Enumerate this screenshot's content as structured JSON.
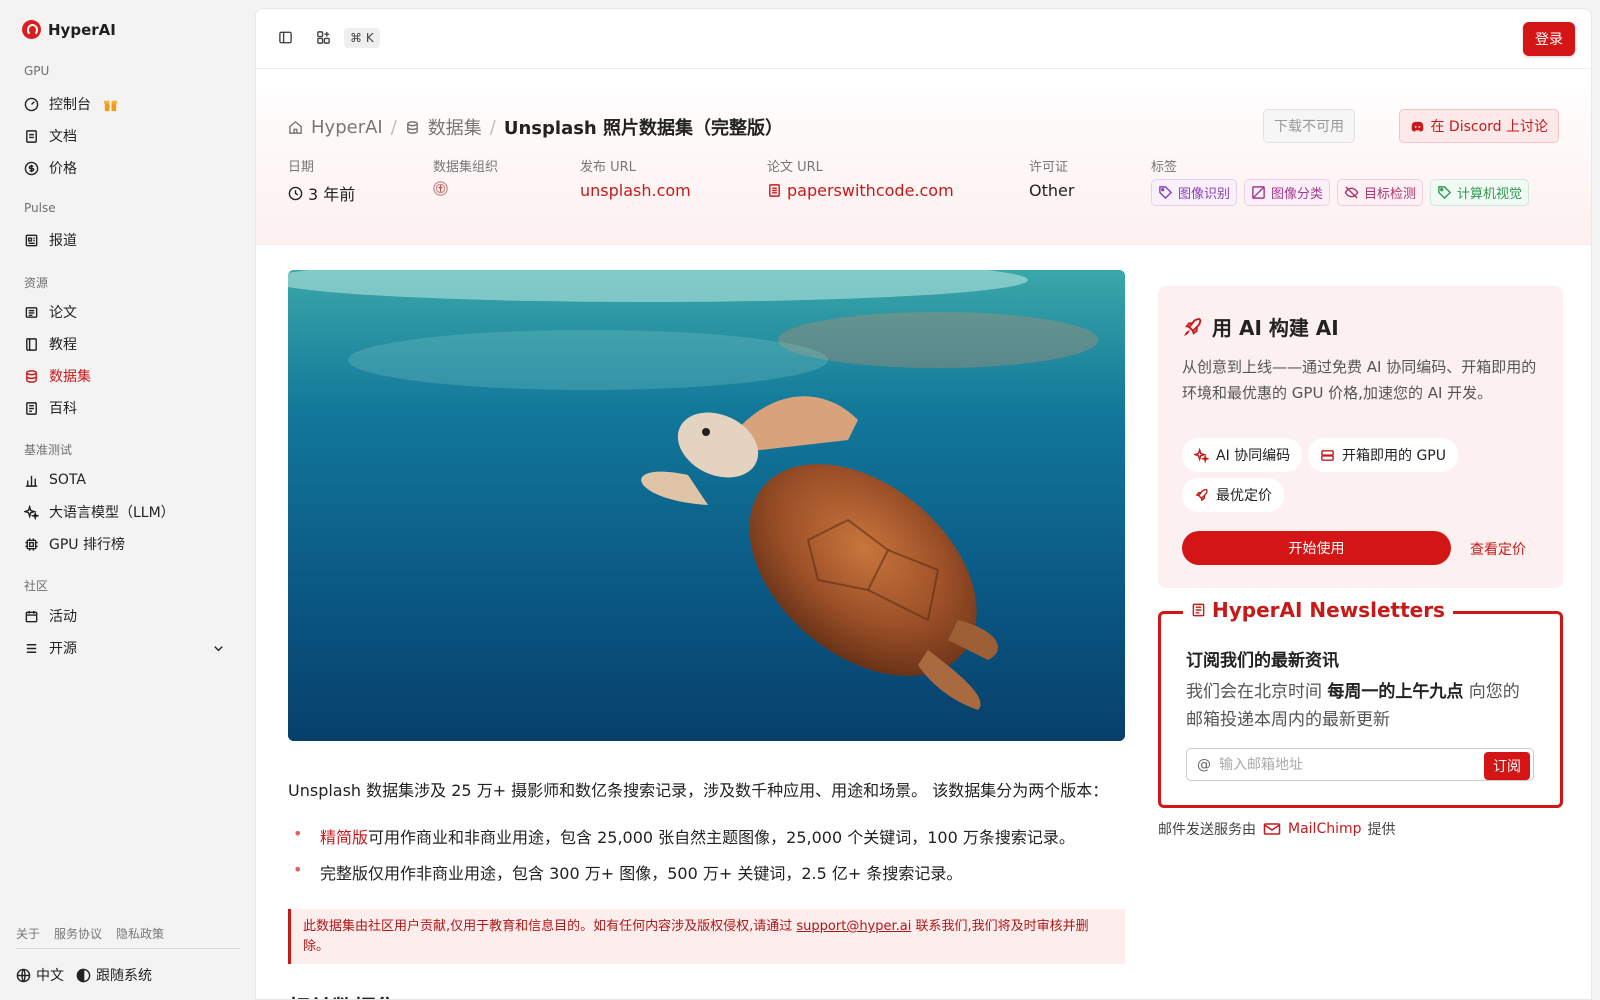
{
  "brand": {
    "name": "HyperAI"
  },
  "sidebar": {
    "sections": [
      "GPU",
      "Pulse",
      "资源",
      "基准测试",
      "社区"
    ],
    "items": [
      {
        "label": "控制台",
        "icon": "gauge-icon"
      },
      {
        "label": "文档",
        "icon": "document-icon"
      },
      {
        "label": "价格",
        "icon": "dollar-icon"
      },
      {
        "label": "报道",
        "icon": "newspaper-icon"
      },
      {
        "label": "论文",
        "icon": "paper-icon"
      },
      {
        "label": "教程",
        "icon": "book-icon"
      },
      {
        "label": "数据集",
        "icon": "database-icon",
        "active": true
      },
      {
        "label": "百科",
        "icon": "encyclopedia-icon"
      },
      {
        "label": "SOTA",
        "icon": "bar-chart-icon"
      },
      {
        "label": "大语言模型（LLM）",
        "icon": "sparkles-icon"
      },
      {
        "label": "GPU 排行榜",
        "icon": "cpu-icon"
      },
      {
        "label": "活动",
        "icon": "calendar-icon"
      },
      {
        "label": "开源",
        "icon": "list-icon"
      }
    ],
    "footer_links": [
      "关于",
      "服务协议",
      "隐私政策"
    ],
    "language": "中文",
    "theme": "跟随系统"
  },
  "topbar": {
    "shortcut": "⌘ K",
    "login": "登录"
  },
  "breadcrumb": {
    "home": "HyperAI",
    "section": "数据集",
    "current": "Unsplash 照片数据集（完整版）"
  },
  "actions": {
    "download": "下载不可用",
    "discord": "在 Discord 上讨论"
  },
  "meta": {
    "date_label": "日期",
    "date_value": "3 年前",
    "org_label": "数据集组织",
    "publish_label": "发布 URL",
    "publish_value": "unsplash.com",
    "paper_label": "论文 URL",
    "paper_value": "paperswithcode.com",
    "license_label": "许可证",
    "license_value": "Other",
    "tags_label": "标签",
    "tags": [
      {
        "label": "图像识别",
        "color": "#8a3fb8"
      },
      {
        "label": "图像分类",
        "color": "#a23a8e"
      },
      {
        "label": "目标检测",
        "color": "#b0346b"
      },
      {
        "label": "计算机视觉",
        "color": "#2f9a52"
      }
    ]
  },
  "content": {
    "description": "Unsplash 数据集涉及 25 万+ 摄影师和数亿条搜索记录，涉及数千种应用、用途和场景。 该数据集分为两个版本：",
    "bullet1_highlight": "精简版",
    "bullet1_text": "可用作商业和非商业用途，包含 25,000 张自然主题图像，25,000 个关键词，100 万条搜索记录。",
    "bullet2_text": "完整版仅用作非商业用途，包含 300 万+ 图像，500 万+ 关键词，2.5 亿+ 条搜索记录。",
    "notice_text": "此数据集由社区用户贡献,仅用于教育和信息目的。如有任何内容涉及版权侵权,请通过 ",
    "notice_email": "support@hyper.ai",
    "notice_tail": " 联系我们,我们将及时审核并删除。",
    "related_title": "相关数据集"
  },
  "promo": {
    "title": "用 AI 构建 AI",
    "text": "从创意到上线——通过免费 AI 协同编码、开箱即用的环境和最优惠的 GPU 价格,加速您的 AI 开发。",
    "chips": [
      "AI 协同编码",
      "开箱即用的 GPU",
      "最优定价"
    ],
    "start": "开始使用",
    "pricing": "查看定价"
  },
  "newsletter": {
    "title": "HyperAI Newsletters",
    "subtitle": "订阅我们的最新资讯",
    "text_pre": "我们会在北京时间 ",
    "text_bold": "每周一的上午九点",
    "text_post": " 向您的邮箱投递本周内的最新更新",
    "placeholder": "输入邮箱地址",
    "subscribe": "订阅",
    "provider_pre": "邮件发送服务由",
    "provider": "MailChimp",
    "provider_post": "提供"
  },
  "colors": {
    "accent": "#d41515",
    "sidebar_bg": "#f4f3f3"
  }
}
